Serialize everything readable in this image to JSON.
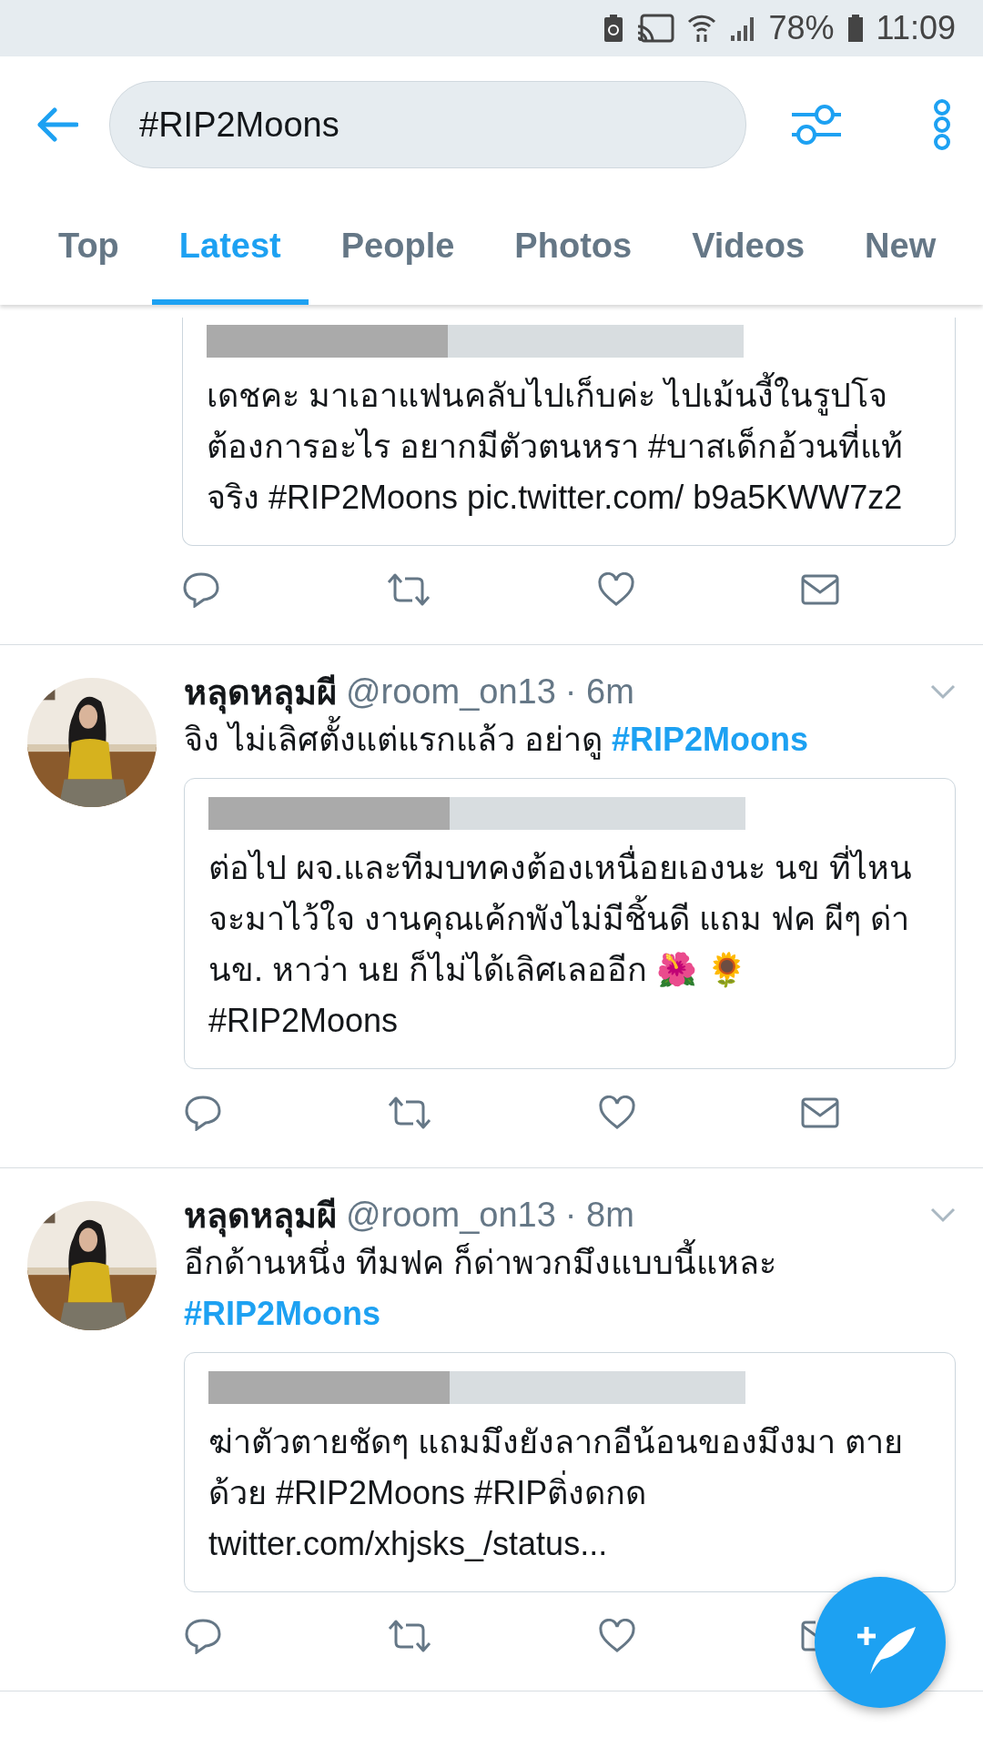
{
  "status_bar": {
    "battery": "78%",
    "time": "11:09"
  },
  "search": {
    "value": "#RIP2Moons"
  },
  "tabs": [
    {
      "label": "Top",
      "selected": false
    },
    {
      "label": "Latest",
      "selected": true
    },
    {
      "label": "People",
      "selected": false
    },
    {
      "label": "Photos",
      "selected": false
    },
    {
      "label": "Videos",
      "selected": false
    },
    {
      "label": "New",
      "selected": false
    }
  ],
  "tweets": [
    {
      "kind": "cut",
      "quote": {
        "text": "เดชคะ มาเอาแฟนคลับไปเก็บค่ะ ไปเม้นงี้ในรูปโจ ต้องการอะไร อยากมีตัวตนหรา #บาสเด็กอ้วนที่แท้จริง #RIP2Moons pic.twitter.com/ b9a5KWW7z2"
      }
    },
    {
      "kind": "full",
      "name": "หลุดหลุมผี",
      "handle": "@room_on13",
      "time": "· 6m",
      "text": "จิง ไม่เลิศตั้งแต่แรกแล้ว อย่าดู",
      "hashtag": "#RIP2Moons",
      "quote": {
        "text": "ต่อไป ผจ.และทีมบทคงต้องเหนื่อยเองนะ นข ที่ไหนจะมาไว้ใจ งานคุณเค้กพังไม่มีชิ้นดี แถม ฟค ผีๆ ด่า นข. หาว่า นย ก็ไม่ได้เลิศเลออีก 🌺 🌻 #RIP2Moons"
      }
    },
    {
      "kind": "full",
      "name": "หลุดหลุมผี",
      "handle": "@room_on13",
      "time": "· 8m",
      "text": "อีกด้านหนึ่ง ทีมฟค ก็ด่าพวกมึงแบบนี้แหละ",
      "hashtag": "#RIP2Moons",
      "quote": {
        "text": "ฆ่าตัวตายชัดๆ แถมมึงยังลากอีน้อนของมึงมา ตายด้วย #RIP2Moons #RIPติ่งดกด twitter.com/xhjsks_/status..."
      }
    }
  ]
}
